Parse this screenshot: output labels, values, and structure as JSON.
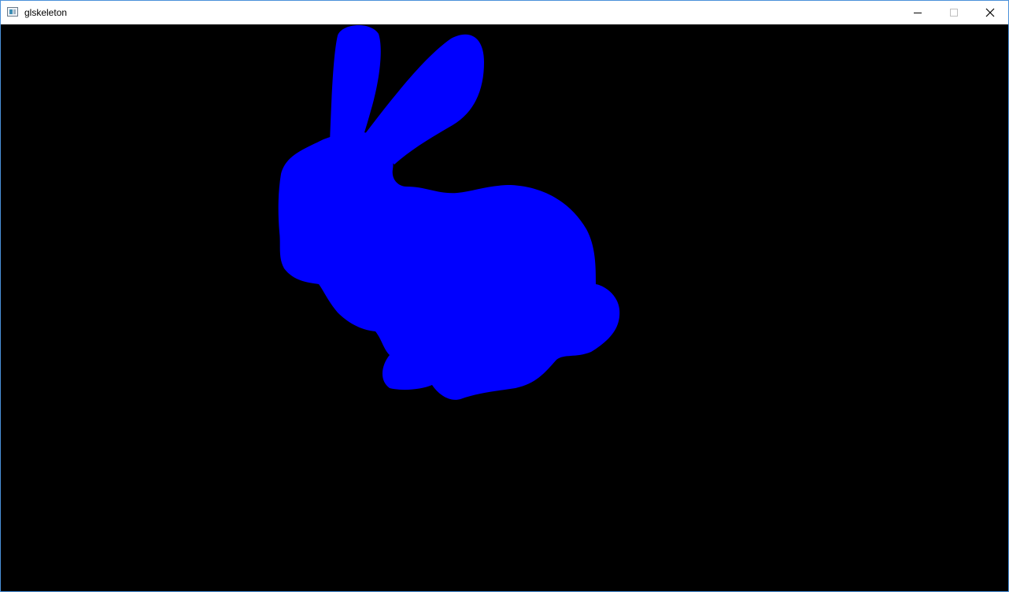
{
  "window": {
    "title": "glskeleton",
    "icon": "app-window-icon",
    "controls": {
      "minimize_icon": "minimize-icon",
      "maximize_icon": "maximize-icon",
      "close_icon": "close-icon"
    }
  },
  "viewport": {
    "background_color": "#000000",
    "model": "bunny-silhouette",
    "model_color": "#0000ff"
  }
}
